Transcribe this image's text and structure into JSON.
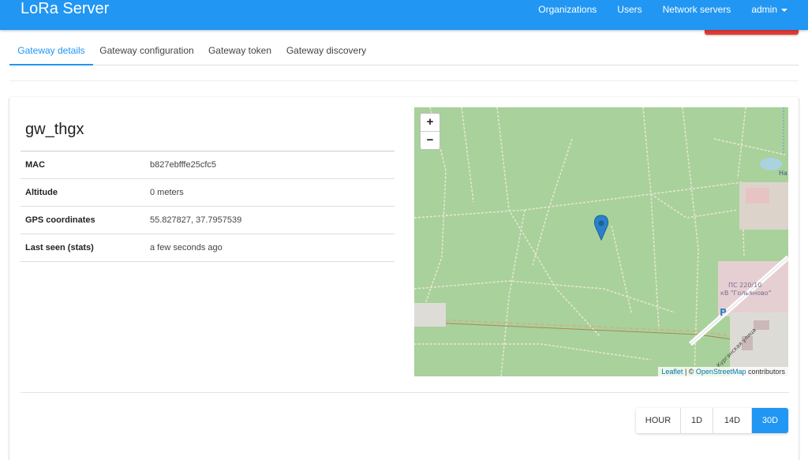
{
  "app": {
    "title": "LoRa Server"
  },
  "nav": {
    "organizations": "Organizations",
    "users": "Users",
    "network_servers": "Network servers",
    "admin": "admin"
  },
  "tabs": [
    {
      "label": "Gateway details"
    },
    {
      "label": "Gateway configuration"
    },
    {
      "label": "Gateway token"
    },
    {
      "label": "Gateway discovery"
    }
  ],
  "gateway": {
    "name": "gw_thgx",
    "rows": [
      {
        "key": "MAC",
        "value": "b827ebfffe25cfc5"
      },
      {
        "key": "Altitude",
        "value": "0 meters"
      },
      {
        "key": "GPS coordinates",
        "value": "55.827827, 37.7957539"
      },
      {
        "key": "Last seen (stats)",
        "value": "a few seconds ago"
      }
    ]
  },
  "map": {
    "zoom_in": "+",
    "zoom_out": "−",
    "attribution_leaflet": "Leaflet",
    "attribution_sep": " | © ",
    "attribution_osm": "OpenStreetMap",
    "attribution_suffix": " contributors",
    "label_substation_1": "ПС 220/10",
    "label_substation_2": "кВ \"Гольяново\"",
    "label_street": "Курганская улица",
    "label_parking": "P",
    "label_partial": "На"
  },
  "range_buttons": [
    "HOUR",
    "1D",
    "14D",
    "30D"
  ],
  "selected_range": "30D",
  "colors": {
    "primary": "#2196f3",
    "danger": "#e53935",
    "forest": "#a9d19b"
  }
}
